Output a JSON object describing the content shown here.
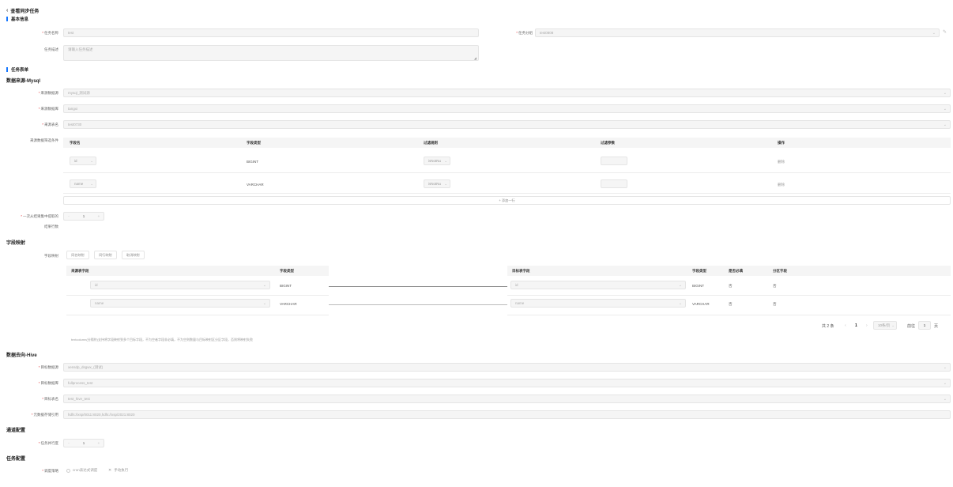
{
  "header": {
    "title": "查看同步任务"
  },
  "basic": {
    "section": "基本信息",
    "task_name_label": "任务名称",
    "task_name_value": "test",
    "task_group_label": "任务分组",
    "task_group_value": "test0808",
    "task_desc_label": "任务描述",
    "task_desc_placeholder": "请输入任务描述"
  },
  "task_form": {
    "section": "任务表单"
  },
  "source": {
    "title": "数据来源-Mysql",
    "datasource_label": "来源数据源",
    "datasource_value": "mysql_测试源",
    "database_label": "来源数据库",
    "database_value": "tangxi",
    "table_label": "来源表名",
    "table_value": "test0730",
    "filter_label": "来源数据筛选条件",
    "filter_columns": [
      "字段名",
      "字段类型",
      "过滤规则",
      "过滤参数",
      "操作"
    ],
    "filter_rows": [
      {
        "field": "id",
        "type": "BIGINT",
        "rule": "isNotNu",
        "op": "删除"
      },
      {
        "field": "name",
        "type": "VARCHAR",
        "rule": "isNotNu",
        "op": "删除"
      }
    ],
    "add_row": "+ 添加一行",
    "fetch_label_1": "一次从结果集中提取的",
    "fetch_label_2": "结果行数",
    "fetch_value": "1",
    "fetch_minus": "-",
    "fetch_plus": "+"
  },
  "mapping": {
    "title": "字段映射",
    "label": "字段映射",
    "buttons": [
      "同名映射",
      "同行映射",
      "取消映射"
    ],
    "left_columns": [
      "来源表字段",
      "字段类型"
    ],
    "right_columns": [
      "目标表字段",
      "字段类型",
      "是否必填",
      "分区字段"
    ],
    "rows": [
      {
        "src": "id",
        "src_type": "BIGINT",
        "dst": "id",
        "dst_type": "BIGINT",
        "required": "否",
        "partition": "否"
      },
      {
        "src": "name",
        "src_type": "VARCHAR",
        "dst": "name",
        "dst_type": "VARCHAR",
        "required": "否",
        "partition": "否"
      }
    ],
    "total": "共 2 条",
    "page": "1",
    "page_size": "10条/页",
    "goto": "前往",
    "goto_value": "1",
    "page_unit": "页",
    "note": "textcolumn(分隔符)支持将字段映射到多个目标字段，不为空者字段非必填，不为空则数量与目标映射区分区字段，否则将映射失败"
  },
  "target": {
    "title": "数据去向-Hive",
    "datasource_label": "目标数据源",
    "datasource_value": "xensdp_dsgwx_(测试)",
    "database_label": "目标数据库",
    "database_value": "fullprocess_test",
    "table_label": "目标表名",
    "table_value": "test_hive_test",
    "hdfs_label": "元数据存储引用",
    "hdfs_value": "hdfs://xsp/0011:8020,hdfs://xsp/2021:8020"
  },
  "channel": {
    "title": "通道配置",
    "concurrency_label": "任务并行度",
    "value": "1",
    "minus": "-",
    "plus": "+"
  },
  "schedule": {
    "title": "任务配置",
    "strategy_label": "调度策略",
    "option1": "cron表达式调度",
    "option2": "手动执行"
  }
}
